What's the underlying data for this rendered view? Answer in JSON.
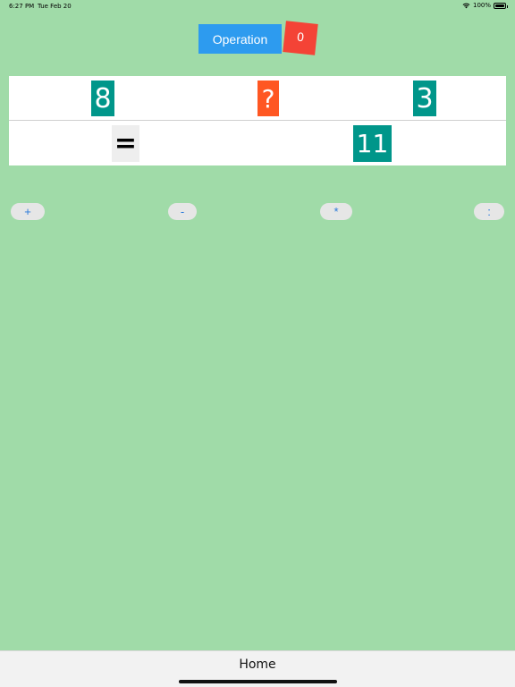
{
  "status_bar": {
    "time": "6:27 PM",
    "date": "Tue Feb 20",
    "battery": "100%"
  },
  "header": {
    "operation_label": "Operation",
    "score": "0"
  },
  "equation": {
    "left": "8",
    "operator_placeholder": "?",
    "right": "3",
    "equals": "=",
    "result": "11"
  },
  "operators": [
    {
      "label": "+"
    },
    {
      "label": "-"
    },
    {
      "label": "*"
    },
    {
      "label": ":"
    }
  ],
  "footer": {
    "home_label": "Home"
  },
  "colors": {
    "background": "#a0dba8",
    "operation_button": "#2d9bef",
    "score_badge": "#f44336",
    "number_tile": "#00968a",
    "unknown_tile": "#ff5722"
  }
}
